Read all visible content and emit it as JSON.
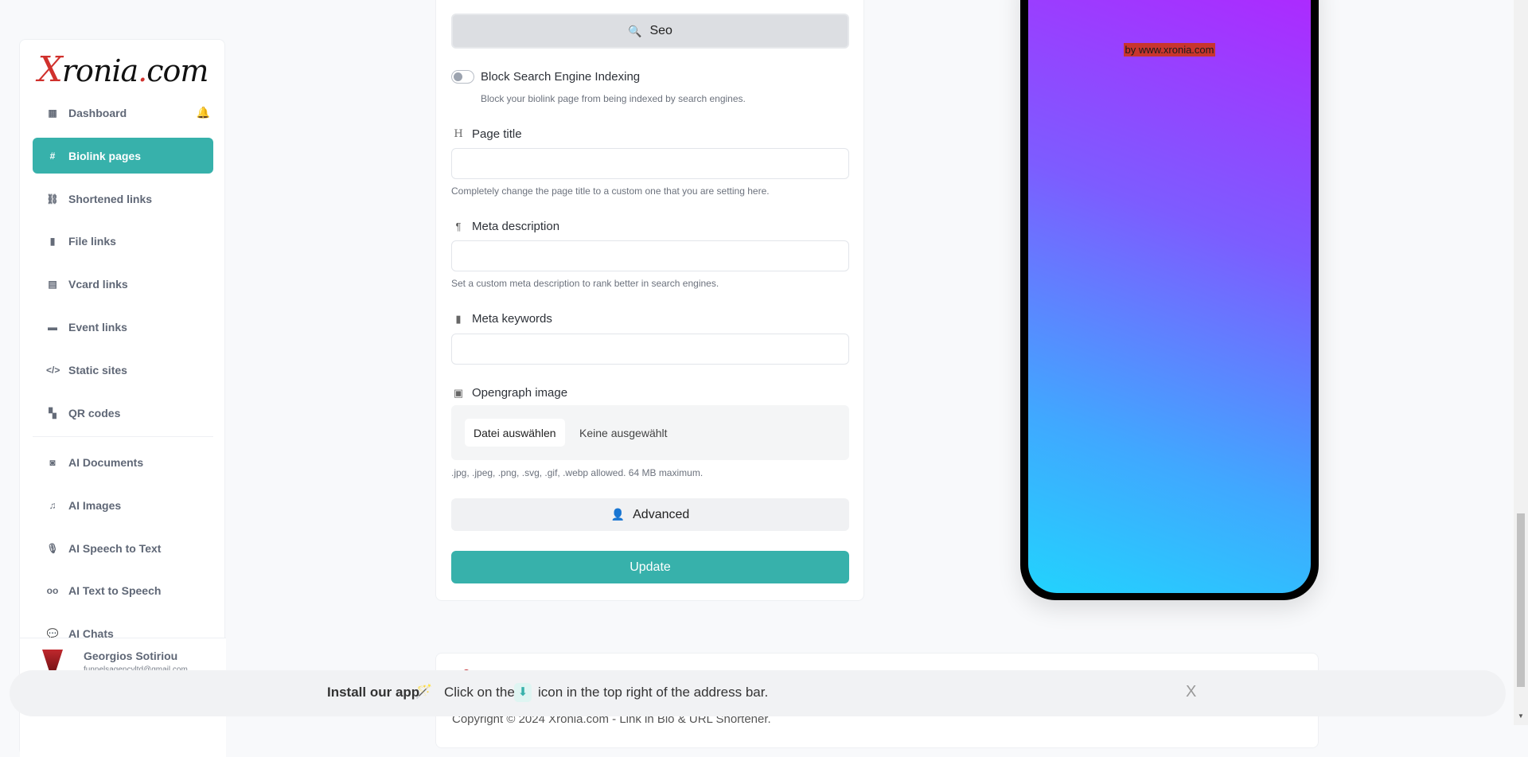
{
  "sidebar": {
    "logo": {
      "x": "X",
      "rest": "ronia",
      "dot": ".",
      "com": "com"
    },
    "items": [
      {
        "label": "Dashboard",
        "icon": "table-icon"
      },
      {
        "label": "Biolink pages",
        "icon": "hashtag-icon",
        "active": true
      },
      {
        "label": "Shortened links",
        "icon": "link-icon"
      },
      {
        "label": "File links",
        "icon": "file-icon"
      },
      {
        "label": "Vcard links",
        "icon": "id-card-icon"
      },
      {
        "label": "Event links",
        "icon": "calendar-icon"
      },
      {
        "label": "Static sites",
        "icon": "code-icon"
      },
      {
        "label": "QR codes",
        "icon": "qrcode-icon"
      },
      {
        "label": "AI Documents",
        "icon": "robot-icon"
      },
      {
        "label": "AI Images",
        "icon": "icons-icon"
      },
      {
        "label": "AI Speech to Text",
        "icon": "microphone-icon"
      },
      {
        "label": "AI Text to Speech",
        "icon": "voicemail-icon"
      },
      {
        "label": "AI Chats",
        "icon": "comments-icon"
      }
    ],
    "user": {
      "name": "Georgios Sotiriou",
      "email": "funnelsagencyltd@gmail.com"
    }
  },
  "form": {
    "seo_label": "Seo",
    "block_indexing": {
      "label": "Block Search Engine Indexing",
      "help": "Block your biolink page from being indexed by search engines.",
      "enabled": false
    },
    "page_title": {
      "label": "Page title",
      "value": "",
      "help": "Completely change the page title to a custom one that you are setting here."
    },
    "meta_description": {
      "label": "Meta description",
      "value": "",
      "help": "Set a custom meta description to rank better in search engines."
    },
    "meta_keywords": {
      "label": "Meta keywords",
      "value": ""
    },
    "opengraph": {
      "label": "Opengraph image",
      "choose": "Datei auswählen",
      "none": "Keine ausgewählt",
      "help": ".jpg, .jpeg, .png, .svg, .gif, .webp allowed. 64 MB maximum."
    },
    "advanced_label": "Advanced",
    "update_label": "Update"
  },
  "preview": {
    "branding": "by www.xronia.com"
  },
  "footer": {
    "copyright": "Copyright © 2024 Xronia.com - Link in Bio & URL Shortener."
  },
  "install_banner": {
    "title": "Install our app",
    "text_before": "Click on the",
    "text_after": "icon in the top right of the address bar.",
    "close": "X"
  },
  "colors": {
    "accent": "#37b1ab",
    "brand_red": "#d0312d"
  }
}
